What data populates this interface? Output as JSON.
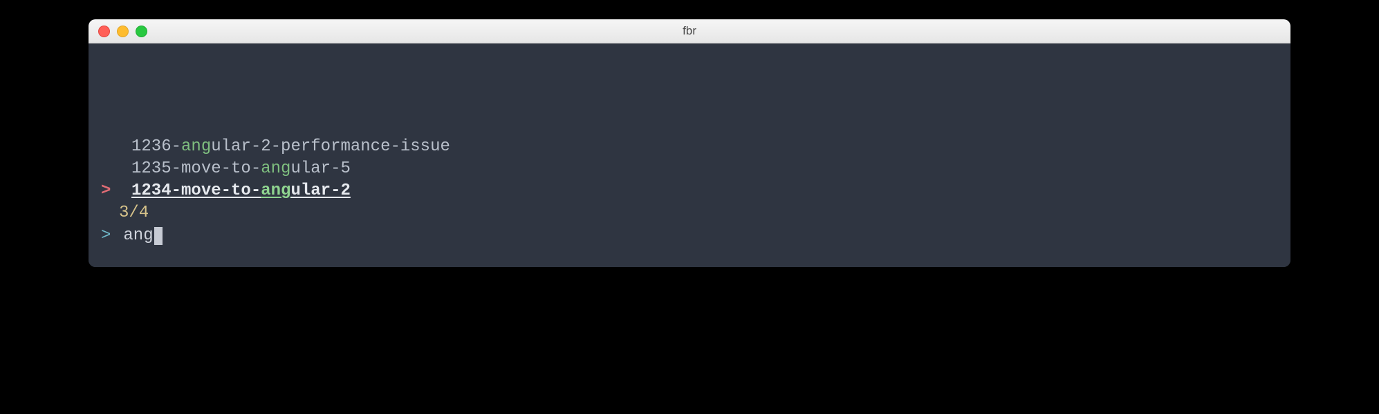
{
  "window": {
    "title": "fbr"
  },
  "results": [
    {
      "pre": "1236-",
      "match": "ang",
      "post": "ular-2-performance-issue",
      "selected": false
    },
    {
      "pre": "1235-move-to-",
      "match": "ang",
      "post": "ular-5",
      "selected": false
    },
    {
      "pre": "1234-move-to-",
      "match": "ang",
      "post": "ular-2",
      "selected": true
    }
  ],
  "count": "3/4",
  "prompt": {
    "symbol": ">",
    "query": "ang"
  },
  "pointer": ">"
}
